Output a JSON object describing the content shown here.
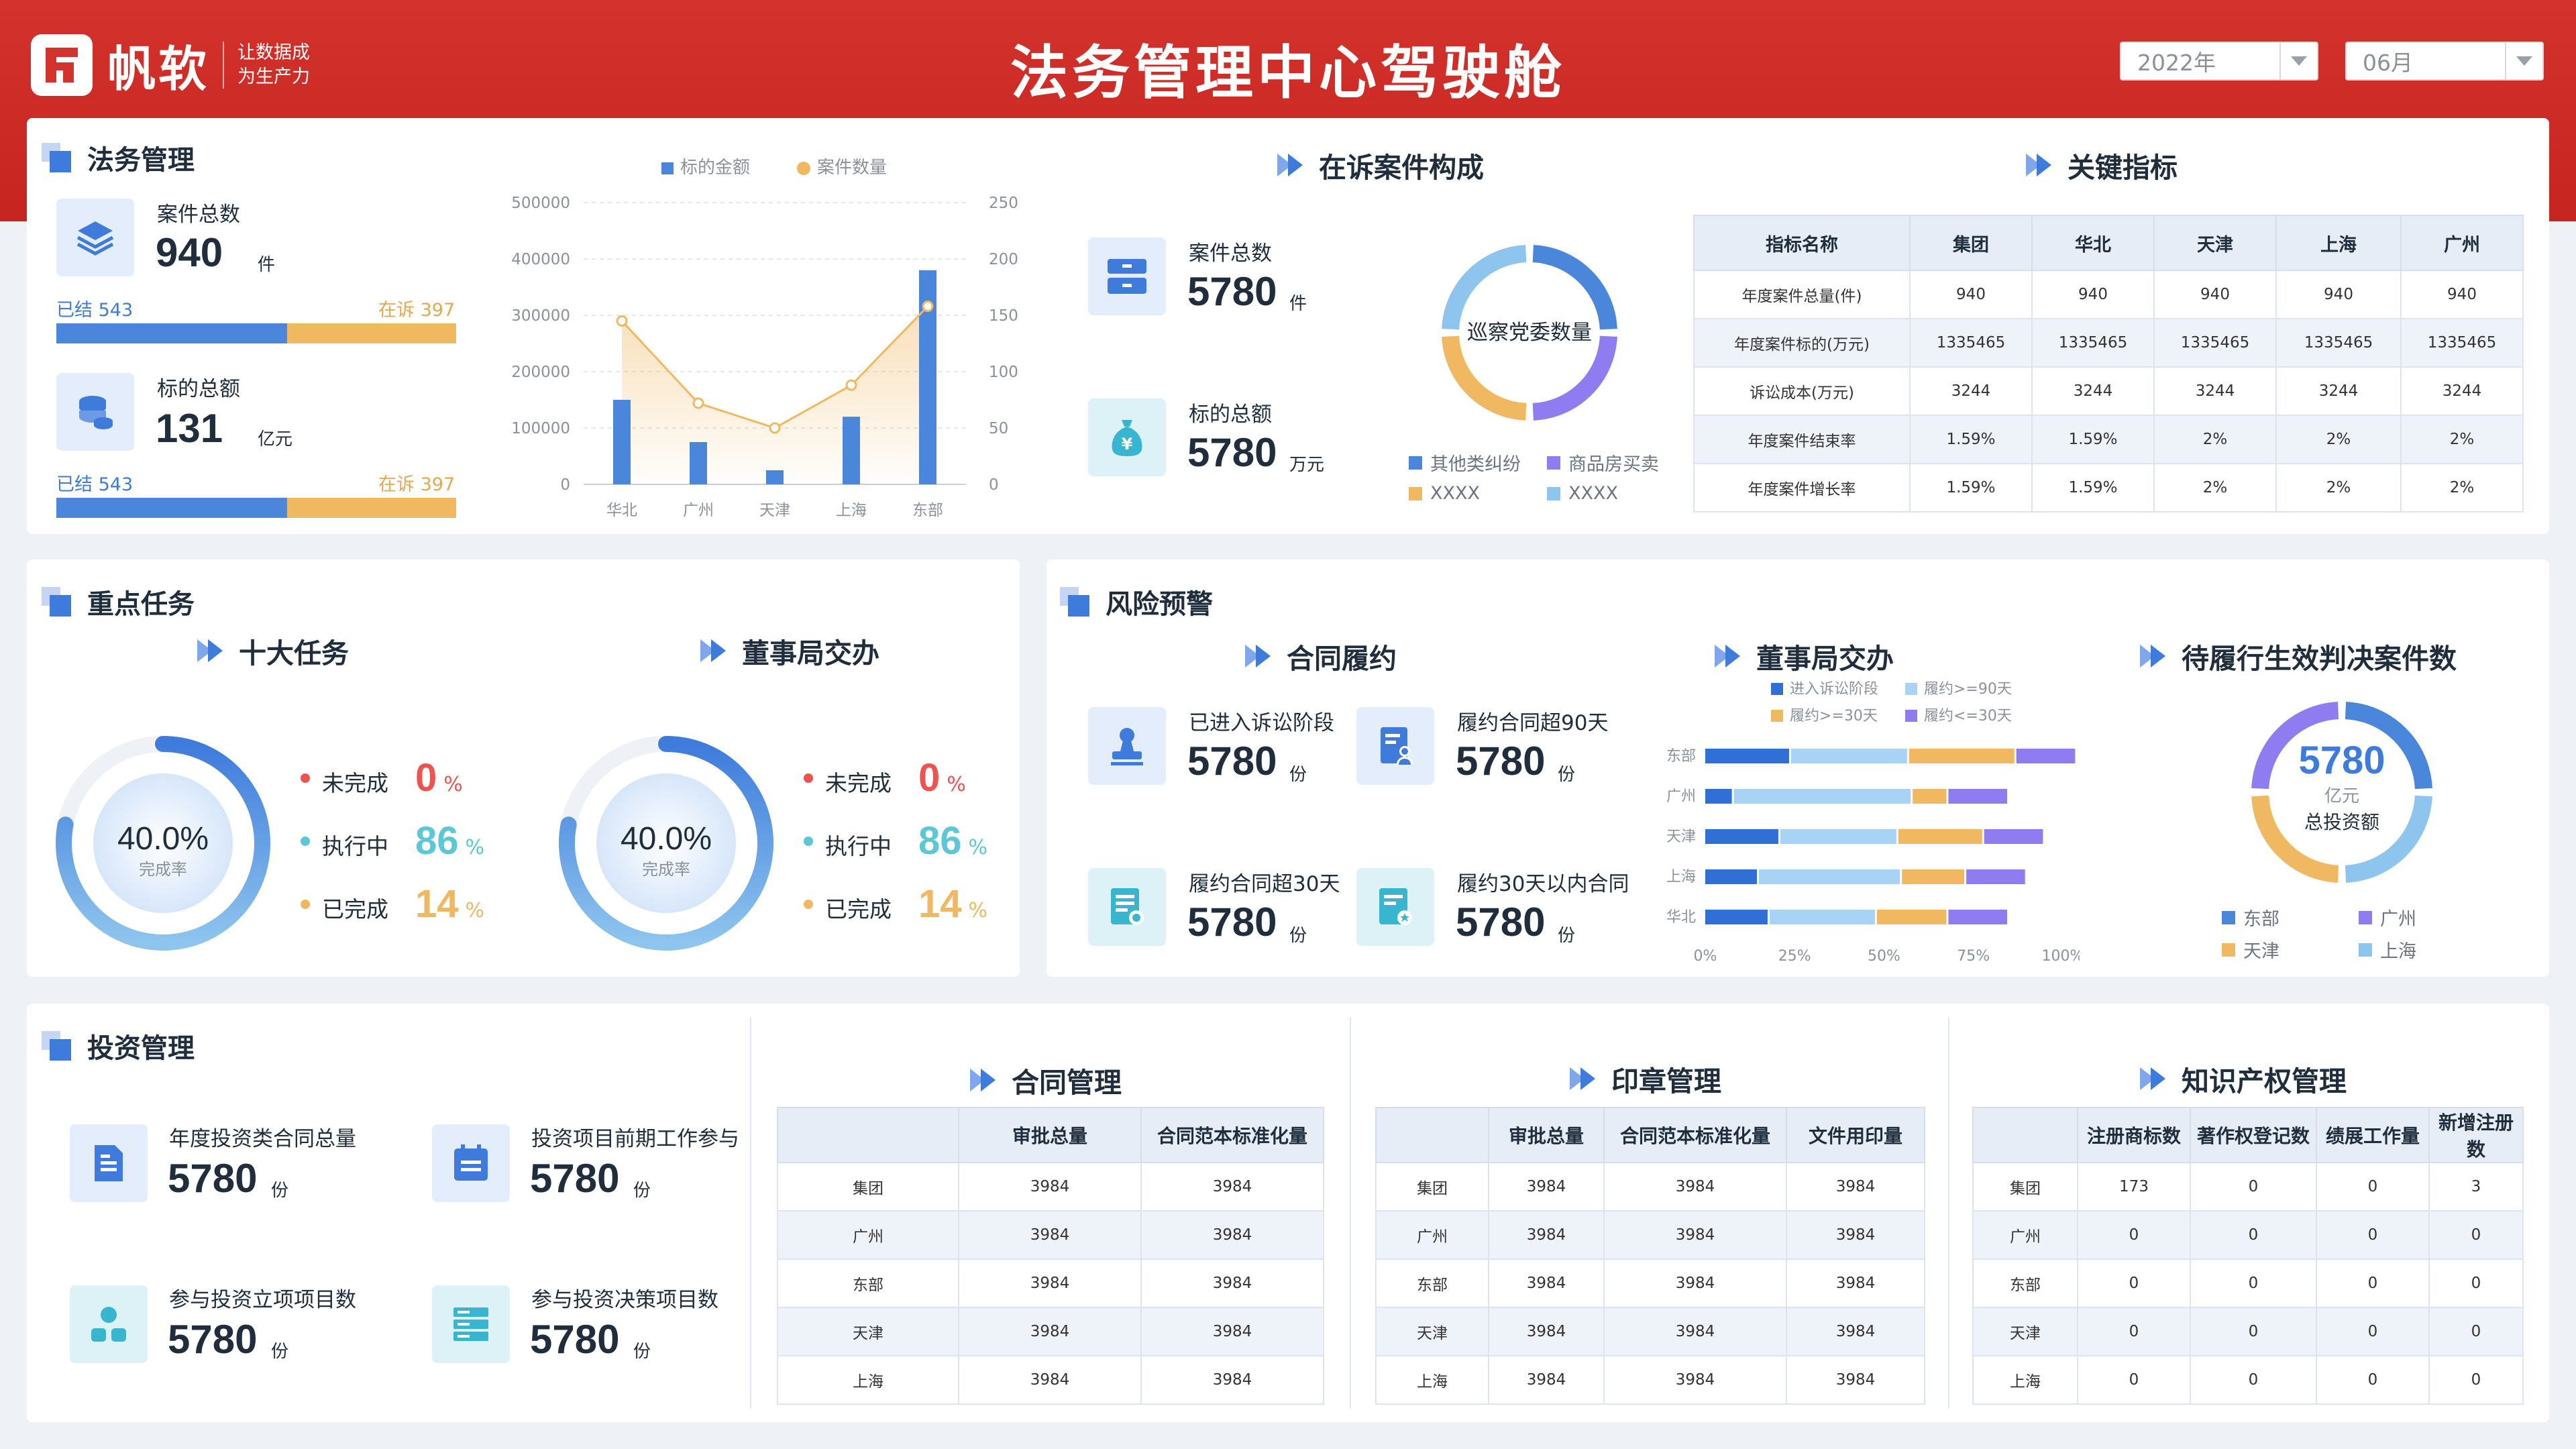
{
  "header": {
    "brand": "帆软",
    "slogan_line1": "让数据成",
    "slogan_line2": "为生产力",
    "title": "法务管理中心驾驶舱",
    "year_select": "2022年",
    "month_select": "06月"
  },
  "legal": {
    "title": "法务管理",
    "case_total_label": "案件总数",
    "case_total_value": "940",
    "case_total_unit": "件",
    "case_bar": {
      "closed_label": "已结 543",
      "pending_label": "在诉 397",
      "closed": 543,
      "pending": 397
    },
    "target_label": "标的总额",
    "target_value": "131",
    "target_unit": "亿元",
    "target_bar": {
      "closed_label": "已结 543",
      "pending_label": "在诉 397",
      "closed": 543,
      "pending": 397
    },
    "chart_data": {
      "type": "bar",
      "categories": [
        "华北",
        "广州",
        "天津",
        "上海",
        "东部"
      ],
      "series": [
        {
          "name": "标的金额",
          "type": "bar",
          "axis": "left",
          "values": [
            150000,
            75000,
            25000,
            120000,
            380000
          ]
        },
        {
          "name": "案件数量",
          "type": "line",
          "axis": "right",
          "values": [
            145,
            72,
            50,
            88,
            158
          ]
        }
      ],
      "y_left": {
        "min": 0,
        "max": 500000,
        "ticks": [
          "0",
          "100000",
          "200000",
          "300000",
          "400000",
          "500000"
        ]
      },
      "y_right": {
        "min": 0,
        "max": 250,
        "ticks": [
          "0",
          "50",
          "100",
          "150",
          "200",
          "250"
        ]
      },
      "legend_position": "top",
      "colors": {
        "bar": "#4a86d9",
        "line": "#f0b860"
      }
    }
  },
  "cases": {
    "title": "在诉案件构成",
    "total_label": "案件总数",
    "total_value": "5780",
    "total_unit": "件",
    "target_label": "标的总额",
    "target_value": "5780",
    "target_unit": "万元",
    "donut_center": "巡察党委数量",
    "chart_data": {
      "type": "pie",
      "donut": true,
      "slices": [
        {
          "name": "其他类纠纷",
          "value": 25,
          "color": "#4a86d9"
        },
        {
          "name": "商品房买卖",
          "value": 25,
          "color": "#8f7cf0"
        },
        {
          "name": "XXXX",
          "value": 25,
          "color": "#f0b860"
        },
        {
          "name": "XXXX",
          "value": 25,
          "color": "#8ec5ee"
        }
      ]
    }
  },
  "kpi": {
    "title": "关键指标",
    "columns": [
      "指标名称",
      "集团",
      "华北",
      "天津",
      "上海",
      "广州"
    ],
    "rows": [
      [
        "年度案件总量(件)",
        "940",
        "940",
        "940",
        "940",
        "940"
      ],
      [
        "年度案件标的(万元)",
        "1335465",
        "1335465",
        "1335465",
        "1335465",
        "1335465"
      ],
      [
        "诉讼成本(万元)",
        "3244",
        "3244",
        "3244",
        "3244",
        "3244"
      ],
      [
        "年度案件结束率",
        "1.59%",
        "1.59%",
        "2%",
        "2%",
        "2%"
      ],
      [
        "年度案件增长率",
        "1.59%",
        "1.59%",
        "2%",
        "2%",
        "2%"
      ]
    ]
  },
  "tasks": {
    "title": "重点任务",
    "groups": [
      {
        "title": "十大任务",
        "rate": "40.0%",
        "rate_value": 0.4,
        "rate_label": "完成率",
        "items": [
          {
            "label": "未完成",
            "value": "0",
            "unit": "%",
            "color": "#ef5350"
          },
          {
            "label": "执行中",
            "value": "86",
            "unit": "%",
            "color": "#5cc7d6"
          },
          {
            "label": "已完成",
            "value": "14",
            "unit": "%",
            "color": "#f0b860"
          }
        ]
      },
      {
        "title": "董事局交办",
        "rate": "40.0%",
        "rate_value": 0.4,
        "rate_label": "完成率",
        "items": [
          {
            "label": "未完成",
            "value": "0",
            "unit": "%",
            "color": "#ef5350"
          },
          {
            "label": "执行中",
            "value": "86",
            "unit": "%",
            "color": "#5cc7d6"
          },
          {
            "label": "已完成",
            "value": "14",
            "unit": "%",
            "color": "#f0b860"
          }
        ]
      }
    ]
  },
  "risk": {
    "title": "风险预警",
    "contract_title": "合同履约",
    "tiles": [
      {
        "label": "已进入诉讼阶段",
        "value": "5780",
        "unit": "份"
      },
      {
        "label": "履约合同超90天",
        "value": "5780",
        "unit": "份"
      },
      {
        "label": "履约合同超30天",
        "value": "5780",
        "unit": "份"
      },
      {
        "label": "履约30天以内合同",
        "value": "5780",
        "unit": "份"
      }
    ],
    "board_title": "董事局交办",
    "board_chart": {
      "type": "bar",
      "orientation": "horizontal",
      "stacked": true,
      "categories": [
        "东部",
        "广州",
        "天津",
        "上海",
        "华北"
      ],
      "series": [
        {
          "name": "进入诉讼阶段",
          "color": "#2f6fd6",
          "values": [
            24,
            8,
            21,
            15,
            18
          ]
        },
        {
          "name": "履约>=30天",
          "color": "#f0b860",
          "values": [
            30,
            10,
            24,
            18,
            20
          ]
        },
        {
          "name": "履约>=90天",
          "color": "#a9d3f5",
          "values": [
            33,
            50,
            33,
            40,
            30
          ]
        },
        {
          "name": "履约<=30天",
          "color": "#8f7cf0",
          "values": [
            17,
            17,
            17,
            17,
            17
          ]
        }
      ],
      "series_order": [
        0,
        2,
        1,
        3
      ],
      "x_ticks": [
        "0%",
        "25%",
        "50%",
        "75%",
        "100%"
      ]
    },
    "pending_title": "待履行生效判决案件数",
    "pending_value": "5780",
    "pending_unit": "亿元",
    "pending_label": "总投资额",
    "pending_chart": {
      "type": "pie",
      "donut": true,
      "slices": [
        {
          "name": "东部",
          "value": 25,
          "color": "#4a86d9"
        },
        {
          "name": "广州",
          "value": 25,
          "color": "#8ec5ee"
        },
        {
          "name": "天津",
          "value": 25,
          "color": "#f0b860"
        },
        {
          "name": "上海",
          "value": 25,
          "color": "#8f7cf0"
        }
      ],
      "legend": [
        {
          "name": "东部",
          "color": "#4a86d9"
        },
        {
          "name": "广州",
          "color": "#8f7cf0"
        },
        {
          "name": "天津",
          "color": "#f0b860"
        },
        {
          "name": "上海",
          "color": "#8ec5ee"
        }
      ]
    }
  },
  "invest": {
    "title": "投资管理",
    "tiles": [
      {
        "label": "年度投资类合同总量",
        "value": "5780",
        "unit": "份"
      },
      {
        "label": "投资项目前期工作参与",
        "value": "5780",
        "unit": "份"
      },
      {
        "label": "参与投资立项项目数",
        "value": "5780",
        "unit": "份"
      },
      {
        "label": "参与投资决策项目数",
        "value": "5780",
        "unit": "份"
      }
    ]
  },
  "contract_mgmt": {
    "title": "合同管理",
    "columns": [
      "",
      "审批总量",
      "合同范本标准化量"
    ],
    "rows": [
      [
        "集团",
        "3984",
        "3984"
      ],
      [
        "广州",
        "3984",
        "3984"
      ],
      [
        "东部",
        "3984",
        "3984"
      ],
      [
        "天津",
        "3984",
        "3984"
      ],
      [
        "上海",
        "3984",
        "3984"
      ]
    ]
  },
  "seal_mgmt": {
    "title": "印章管理",
    "columns": [
      "",
      "审批总量",
      "合同范本标准化量",
      "文件用印量"
    ],
    "rows": [
      [
        "集团",
        "3984",
        "3984",
        "3984"
      ],
      [
        "广州",
        "3984",
        "3984",
        "3984"
      ],
      [
        "东部",
        "3984",
        "3984",
        "3984"
      ],
      [
        "天津",
        "3984",
        "3984",
        "3984"
      ],
      [
        "上海",
        "3984",
        "3984",
        "3984"
      ]
    ]
  },
  "ip_mgmt": {
    "title": "知识产权管理",
    "columns": [
      "",
      "注册商标数",
      "著作权登记数",
      "绩展工作量",
      "新增注册数"
    ],
    "rows": [
      [
        "集团",
        "173",
        "0",
        "0",
        "3"
      ],
      [
        "广州",
        "0",
        "0",
        "0",
        "0"
      ],
      [
        "东部",
        "0",
        "0",
        "0",
        "0"
      ],
      [
        "天津",
        "0",
        "0",
        "0",
        "0"
      ],
      [
        "上海",
        "0",
        "0",
        "0",
        "0"
      ]
    ]
  }
}
